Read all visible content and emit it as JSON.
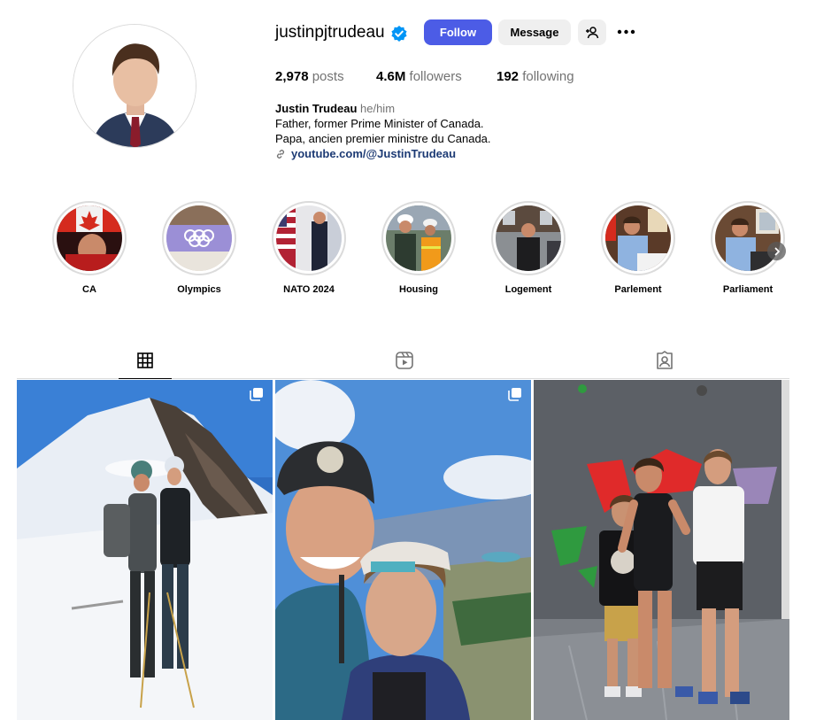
{
  "profile": {
    "username": "justinpjtrudeau",
    "verified": true,
    "follow_label": "Follow",
    "message_label": "Message",
    "stats": {
      "posts_value": "2,978",
      "posts_label": "posts",
      "followers_value": "4.6M",
      "followers_label": "followers",
      "following_value": "192",
      "following_label": "following"
    },
    "full_name": "Justin Trudeau",
    "pronouns": "he/him",
    "bio_line1": "Father, former Prime Minister of Canada.",
    "bio_line2": "Papa, ancien premier ministre du Canada.",
    "link": "youtube.com/@JustinTrudeau"
  },
  "highlights": [
    {
      "label": "CA"
    },
    {
      "label": "Olympics"
    },
    {
      "label": "NATO 2024"
    },
    {
      "label": "Housing"
    },
    {
      "label": "Logement"
    },
    {
      "label": "Parlement"
    },
    {
      "label": "Parliament"
    }
  ],
  "tabs": [
    {
      "name": "posts",
      "icon": "grid-icon",
      "active": true
    },
    {
      "name": "reels",
      "icon": "reels-icon",
      "active": false
    },
    {
      "name": "tagged",
      "icon": "tagged-icon",
      "active": false
    }
  ],
  "posts": [
    {
      "icon": "multi-image-icon"
    },
    {
      "icon": "multi-image-icon"
    },
    {
      "icon": ""
    }
  ],
  "colors": {
    "accent": "#4c5ce6",
    "verified": "#0095f6",
    "link": "#1c3a74",
    "muted": "#737373",
    "button_gray": "#efefef"
  }
}
